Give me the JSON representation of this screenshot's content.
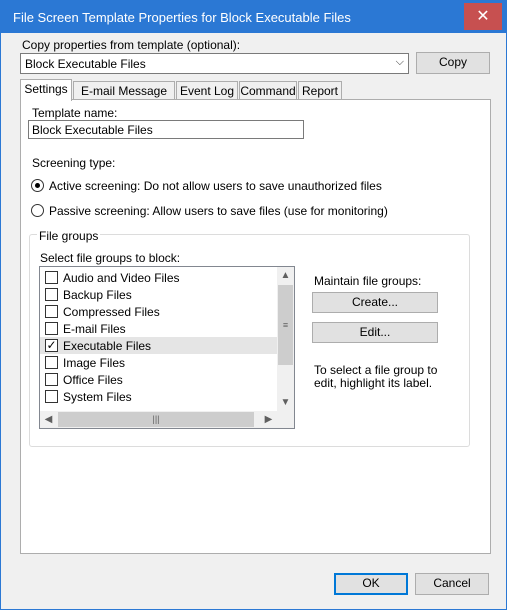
{
  "window": {
    "title": "File Screen Template Properties for Block Executable Files",
    "close_glyph": "✕"
  },
  "copy_section": {
    "label": "Copy properties from template (optional):",
    "template_value": "Block Executable Files",
    "copy_button": "Copy"
  },
  "tabs": [
    {
      "label": "Settings",
      "active": true
    },
    {
      "label": "E-mail Message",
      "active": false
    },
    {
      "label": "Event Log",
      "active": false
    },
    {
      "label": "Command",
      "active": false
    },
    {
      "label": "Report",
      "active": false
    }
  ],
  "settings": {
    "template_name_label": "Template name:",
    "template_name_value": "Block Executable Files",
    "screening_type_label": "Screening type:",
    "active_screening": "Active screening: Do not allow users to save unauthorized files",
    "passive_screening": "Passive screening: Allow users to save files (use for monitoring)",
    "screening_selected": "active"
  },
  "file_groups": {
    "group_label": "File groups",
    "select_label": "Select file groups to block:",
    "items": [
      {
        "label": "Audio and Video Files",
        "checked": false
      },
      {
        "label": "Backup Files",
        "checked": false
      },
      {
        "label": "Compressed Files",
        "checked": false
      },
      {
        "label": "E-mail Files",
        "checked": false
      },
      {
        "label": "Executable Files",
        "checked": true
      },
      {
        "label": "Image Files",
        "checked": false
      },
      {
        "label": "Office Files",
        "checked": false
      },
      {
        "label": "System Files",
        "checked": false
      }
    ],
    "maintain_label": "Maintain file groups:",
    "create_button": "Create...",
    "edit_button": "Edit...",
    "hint_line1": "To select a file group to",
    "hint_line2": "edit, highlight its label."
  },
  "footer": {
    "ok_button": "OK",
    "cancel_button": "Cancel"
  },
  "icons": {
    "dropdown": "⌵",
    "check": "✓",
    "scroll_up": "▲",
    "scroll_down": "▼",
    "scroll_left": "◀",
    "scroll_right": "▶",
    "grip_v": "≡",
    "grip_h": "|||"
  }
}
